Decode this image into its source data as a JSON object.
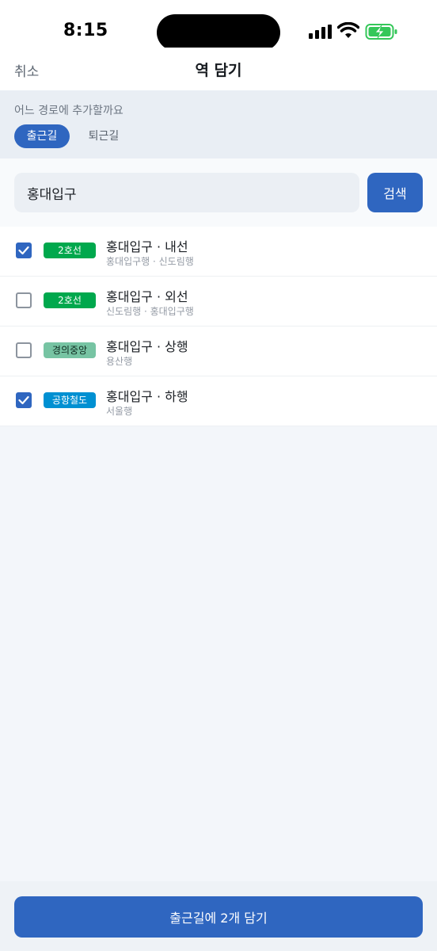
{
  "status_bar": {
    "time": "8:15"
  },
  "nav": {
    "cancel_label": "취소",
    "title": "역 담기"
  },
  "route_selector": {
    "question": "어느 경로에 추가할까요",
    "tabs": [
      {
        "label": "출근길",
        "selected": true
      },
      {
        "label": "퇴근길",
        "selected": false
      }
    ]
  },
  "search": {
    "value": "홍대입구",
    "button_label": "검색"
  },
  "stations": [
    {
      "line": "2호선",
      "line_color": "#00a84d",
      "name": "홍대입구 · 내선",
      "direction": "홍대입구행 · 신도림행",
      "checked": true
    },
    {
      "line": "2호선",
      "line_color": "#00a84d",
      "name": "홍대입구 · 외선",
      "direction": "신도림행 · 홍대입구행",
      "checked": false
    },
    {
      "line": "경의중앙",
      "line_color": "#77c4a3",
      "name": "홍대입구 · 상행",
      "direction": "용산행",
      "checked": false
    },
    {
      "line": "공항철도",
      "line_color": "#0090d2",
      "name": "홍대입구 · 하행",
      "direction": "서울행",
      "checked": true
    }
  ],
  "bottom": {
    "add_button_label": "출근길에 2개 담기"
  },
  "colors": {
    "accent": "#2f66c0",
    "battery": "#34c759"
  },
  "icons": [
    "signal-icon",
    "wifi-icon",
    "battery-charging-icon",
    "checkmark-icon"
  ]
}
